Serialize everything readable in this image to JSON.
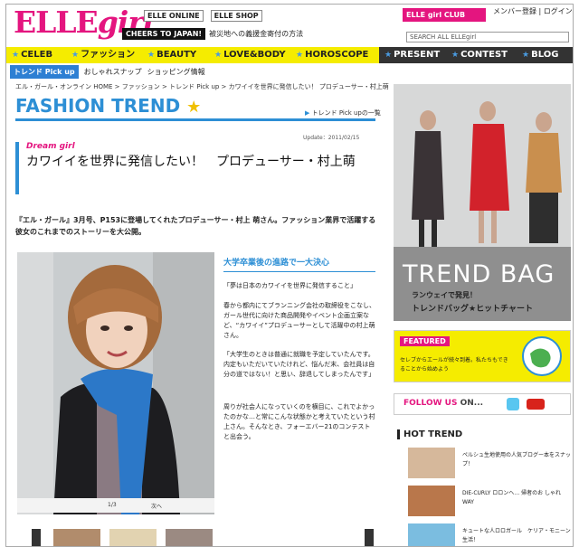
{
  "header": {
    "logo_elle": "ELLE",
    "logo_girl": "girl",
    "links": [
      "ELLE ONLINE",
      "ELLE SHOP"
    ],
    "promo_badge": "CHEERS TO JAPAN!",
    "promo_text": "被災地への義援金寄付の方法",
    "club_label": "ELLE girl CLUB",
    "member_links": "メンバー登録 | ログイン",
    "search_placeholder": "SEARCH ALL ELLEgirl"
  },
  "nav": {
    "items": [
      {
        "label": "CELEB",
        "style": "yellow"
      },
      {
        "label": "ファッション",
        "style": "yellow"
      },
      {
        "label": "BEAUTY",
        "style": "yellow"
      },
      {
        "label": "LOVE&BODY",
        "style": "yellow"
      },
      {
        "label": "HOROSCOPE",
        "style": "yellow"
      },
      {
        "label": "PRESENT",
        "style": "dark"
      },
      {
        "label": "CONTEST",
        "style": "dark"
      },
      {
        "label": "BLOG",
        "style": "dark"
      }
    ]
  },
  "subnav": {
    "badge": "トレンド Pick up",
    "links": [
      "おしゃれスナップ",
      "ショッピング情報"
    ]
  },
  "article": {
    "breadcrumb": "エル・ガール・オンライン HOME > ファッション > トレンド Pick up > カワイイを世界に発信したい！ プロデューサー・村上萌",
    "section_title": "FASHION TREND",
    "back_link": "トレンド Pick upの一覧",
    "update": "Update：2011/02/15",
    "tag": "Dream girl",
    "headline": "カワイイを世界に発信したい！　プロデューサー・村上萌",
    "lead": "『エル・ガール』3月号、P153に登場してくれたプロデューサー・村上 萌さん。ファッション業界で活躍する彼女のこれまでのストーリーを大公開。",
    "photo_counter": "1/3",
    "photo_next": "次へ",
    "subhead": "大学卒業後の進路で一大決心",
    "paragraphs": [
      "「夢は日本のカワイイを世界に発信すること」",
      "春から都内にてブランニング会社の取締役をこなし、ガール世代に向けた商品開発やイベント企画立案など、“カワイイ”プロデューサーとして活躍中の村上萌さん。",
      "「大学生のときは普通に就職を予定していたんです。内定もいただいていたけれど、悩んだ末、会社員は自分の道ではない！と思い、辞退してしまったんです」",
      "周りが社会人になっていくのを横目に、これでよかったのかな…と常にこんな状態かと考えていたという村上さん。そんなとき、フォーエバー21のコンテストと出会う。"
    ]
  },
  "sidebar": {
    "trend_title": "TREND BAG",
    "trend_sub1": "ランウェイで発見！",
    "trend_sub2": "トレンドバッグ★ヒットチャート",
    "featured_tag": "FEATURED",
    "featured_text": "セレブからエールが続々到着。私たちもできることから始めよう",
    "follow_label": "FOLLOW US",
    "follow_on": "ON...",
    "hot_trend": "HOT TREND",
    "hot_items": [
      "ペルシュ生地使用の人気ブログー本をスナップ！",
      "DIE-CURLY ロロンヘ… 帰者のお しゃれWAY",
      "キュートな人ロロガール　ケリア・モニーン生活！"
    ]
  },
  "colors": {
    "brand_pink": "#e4157f",
    "accent_blue": "#2d8fd5",
    "nav_yellow": "#f5ec00"
  }
}
